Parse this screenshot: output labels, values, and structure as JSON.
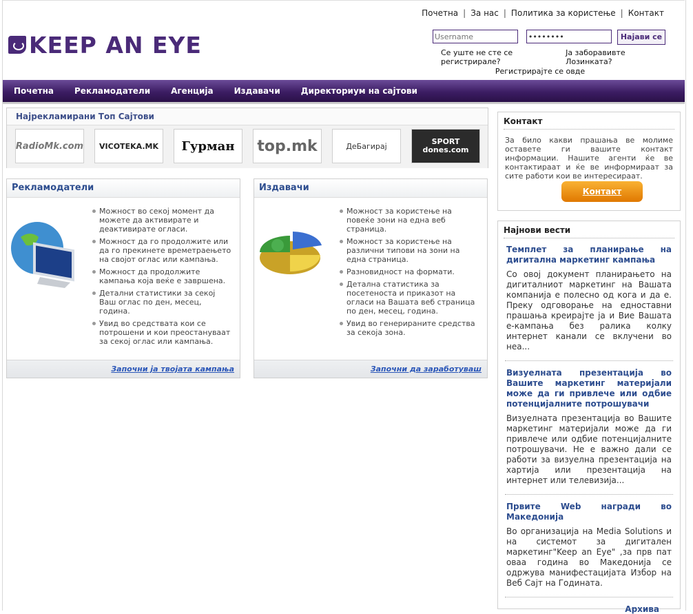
{
  "header": {
    "logo_text": "KEEP AN EYE",
    "top_links": [
      "Почетна",
      "За нас",
      "Политика за користење",
      "Контакт"
    ],
    "login": {
      "username_placeholder": "Username",
      "password_value": "••••••••",
      "submit_label": "Најави се",
      "not_registered": "Се уште не сте се регистрирале?",
      "forgot_password": "Ја заборавивте Лозинката?",
      "register_prefix": "Регистрирајте се",
      "register_link": "овде"
    }
  },
  "nav": [
    "Почетна",
    "Рекламодатели",
    "Агенција",
    "Издавачи",
    "Директориум на сајтови"
  ],
  "top_sites": {
    "title": "Најрекламирани Топ Сајтови",
    "sites": [
      "RadioMk.com",
      "VICOTEKA.MK",
      "Гурман",
      "top.mk",
      "ДеБагирај",
      "SPORT dones.com"
    ]
  },
  "advertisers": {
    "title": "Рекламодатели",
    "items": [
      "Можност во секој момент да можете да активирате и деактивирате огласи.",
      "Можност да го продолжите или да го прекинете времетраењето на својот оглас или кампања.",
      "Можност да продолжите кампања која веќе е завршена.",
      "Детални статистики за секој Ваш оглас по ден, месец, година.",
      "Увид во средствата кои се потрошени и кои преостануваат за секој оглас или кампања."
    ],
    "footer_link": "Започни ја твојата кампања"
  },
  "publishers": {
    "title": "Издавачи",
    "items": [
      "Можност за користење на повеќе зони на една веб страница.",
      "Можност за користење на различни типови на зони на една страница.",
      "Разновидност на формати.",
      "Детална статистика за посетеноста и приказот на огласи на Вашата веб страница по ден, месец, година.",
      "Увид во генерираните средства за секоја зона."
    ],
    "footer_link": "Започни да заработуваш"
  },
  "contact": {
    "title": "Контакт",
    "text": "За било какви прашања ве молиме оставете ги вашите контакт информации. Нашите агенти ќе ве контактираат и ќе ве информираат за сите работи кои ве интересираат.",
    "button": "Контакт"
  },
  "news": {
    "title": "Најнови вести",
    "items": [
      {
        "headline": "Темплет за планирање на дигитална маркетинг кампања",
        "body": "Со овој документ планирањето на дигиталниот маркетинг на Вашата компанија е полесно од кога и да е. Преку одговорање на едноставни прашања креирајте ја и Вие Вашата е-кампања без ралика колку интернет канали се вклучени во неа..."
      },
      {
        "headline": "Визуелната презентација во Вашите маркетинг материјали може да ги привлече или одбие потенцијалните потрошувачи",
        "body": "Визуелната презентација во Вашите маркетинг материјали може да ги привлече или одбие потенцијалните потрошувачи. Не е важно дали се работи за визуелна презентација на хартија или презентација на интернет или телевизија..."
      },
      {
        "headline": "Првите Web награди во Македонија",
        "body": "Во организација на Media Solutions и на системот за дигитален маркетинг\"Keep an Eye\" ,за прв пат оваа година во Македонија се одржува манифестацијата Избор на Веб Сајт на Годината."
      }
    ],
    "archive": "Архива"
  }
}
